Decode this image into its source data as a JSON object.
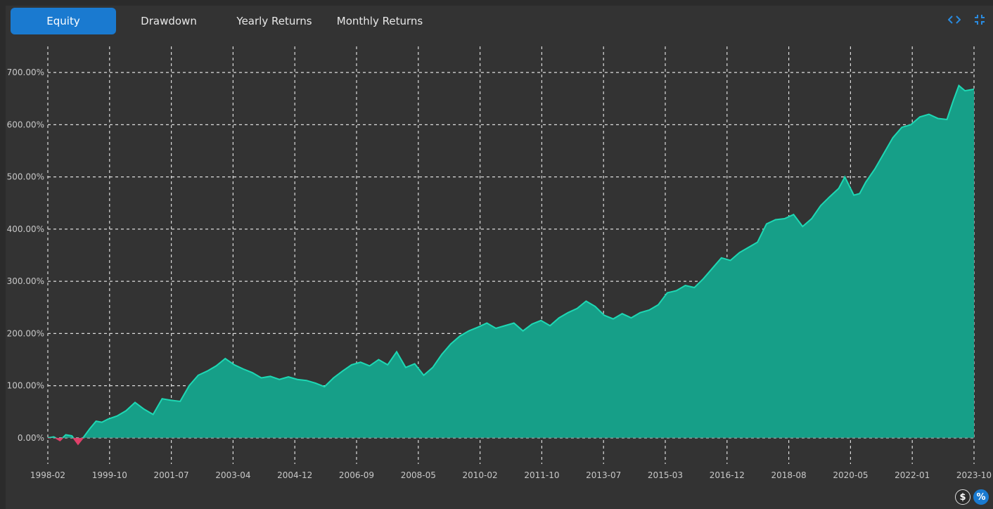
{
  "tabs": {
    "equity": "Equity",
    "drawdown": "Drawdown",
    "yearly": "Yearly Returns",
    "monthly": "Monthly Returns"
  },
  "controls": {
    "code_icon": "code-icon",
    "collapse_icon": "collapse-icon",
    "dollar_label": "$",
    "percent_label": "%"
  },
  "colors": {
    "active_tab": "#1a7ad0",
    "positive_fill": "#169f88",
    "positive_line": "#1ed8b4",
    "negative_fill": "#e0406a",
    "grid": "#dcdcdc",
    "background": "#333333"
  },
  "chart_data": {
    "type": "area",
    "x_tick_labels": [
      "1998-02",
      "1999-10",
      "2001-07",
      "2003-04",
      "2004-12",
      "2006-09",
      "2008-05",
      "2010-02",
      "2011-10",
      "2013-07",
      "2015-03",
      "2016-12",
      "2018-08",
      "2020-05",
      "2022-01",
      "2023-10"
    ],
    "y_tick_labels": [
      "0.00%",
      "100.00%",
      "200.00%",
      "300.00%",
      "400.00%",
      "500.00%",
      "600.00%",
      "700.00%"
    ],
    "ylim": [
      -50,
      750
    ],
    "xlim": [
      1998.083,
      2023.75
    ],
    "grid": true,
    "x": [
      1998.08,
      1998.25,
      1998.42,
      1998.58,
      1998.75,
      1998.92,
      1999.08,
      1999.25,
      1999.42,
      1999.58,
      1999.75,
      2000.0,
      2000.25,
      2000.5,
      2000.75,
      2001.0,
      2001.25,
      2001.5,
      2001.75,
      2002.0,
      2002.25,
      2002.5,
      2002.75,
      2003.0,
      2003.25,
      2003.5,
      2003.75,
      2004.0,
      2004.25,
      2004.5,
      2004.75,
      2005.0,
      2005.25,
      2005.5,
      2005.75,
      2006.0,
      2006.25,
      2006.5,
      2006.75,
      2007.0,
      2007.25,
      2007.5,
      2007.75,
      2008.0,
      2008.25,
      2008.5,
      2008.75,
      2009.0,
      2009.25,
      2009.5,
      2009.75,
      2010.0,
      2010.25,
      2010.5,
      2010.75,
      2011.0,
      2011.25,
      2011.5,
      2011.75,
      2012.0,
      2012.25,
      2012.5,
      2012.75,
      2013.0,
      2013.25,
      2013.5,
      2013.75,
      2014.0,
      2014.25,
      2014.5,
      2014.75,
      2015.0,
      2015.25,
      2015.5,
      2015.75,
      2016.0,
      2016.25,
      2016.5,
      2016.75,
      2017.0,
      2017.25,
      2017.5,
      2017.75,
      2018.0,
      2018.25,
      2018.5,
      2018.75,
      2019.0,
      2019.25,
      2019.5,
      2019.75,
      2020.0,
      2020.17,
      2020.42,
      2020.58,
      2020.75,
      2021.0,
      2021.25,
      2021.5,
      2021.75,
      2022.0,
      2022.25,
      2022.5,
      2022.75,
      2023.0,
      2023.17,
      2023.33,
      2023.5,
      2023.75
    ],
    "values": [
      0,
      2,
      -5,
      6,
      4,
      -12,
      2,
      18,
      32,
      30,
      36,
      42,
      52,
      68,
      55,
      45,
      75,
      72,
      70,
      100,
      120,
      128,
      138,
      152,
      140,
      132,
      125,
      115,
      118,
      112,
      117,
      112,
      110,
      105,
      98,
      115,
      128,
      140,
      145,
      138,
      150,
      140,
      165,
      135,
      142,
      120,
      135,
      160,
      180,
      195,
      205,
      212,
      220,
      210,
      215,
      220,
      205,
      218,
      225,
      215,
      230,
      240,
      248,
      262,
      252,
      235,
      228,
      238,
      230,
      240,
      245,
      255,
      278,
      282,
      292,
      288,
      305,
      325,
      345,
      340,
      355,
      365,
      375,
      410,
      418,
      420,
      428,
      405,
      420,
      445,
      462,
      478,
      500,
      465,
      468,
      490,
      515,
      545,
      575,
      595,
      600,
      615,
      620,
      612,
      610,
      645,
      675,
      665,
      668
    ]
  }
}
